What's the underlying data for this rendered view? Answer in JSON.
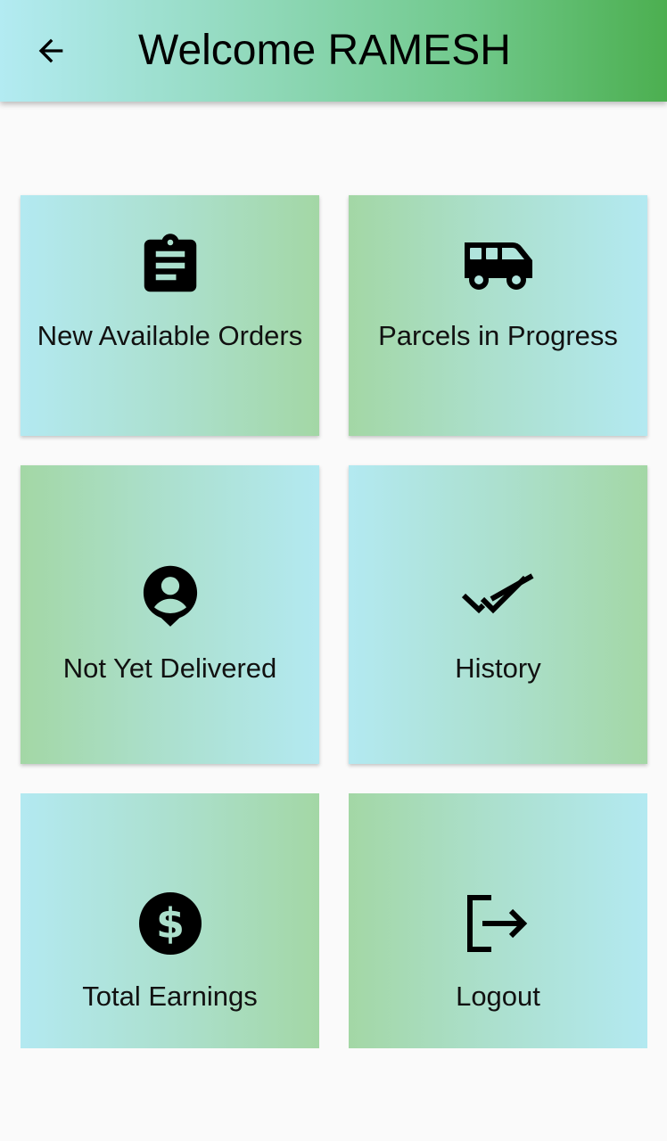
{
  "app_bar": {
    "back_icon": "arrow-back-icon",
    "title": "Welcome RAMESH",
    "gradient_start": "#b3ebf2",
    "gradient_end": "#4caf50"
  },
  "cards": [
    {
      "label": "New Available Orders",
      "icon": "clipboard-icon"
    },
    {
      "label": "Parcels in Progress",
      "icon": "van-icon"
    },
    {
      "label": "Not Yet Delivered",
      "icon": "person-pin-icon"
    },
    {
      "label": "History",
      "icon": "double-check-icon"
    },
    {
      "label": "Total Earnings",
      "icon": "dollar-icon"
    },
    {
      "label": "Logout",
      "icon": "logout-icon"
    }
  ],
  "colors": {
    "card_blue": "#b3e9f1",
    "card_green": "#a3d7a5",
    "background": "#fafafa",
    "icon": "#000000"
  }
}
